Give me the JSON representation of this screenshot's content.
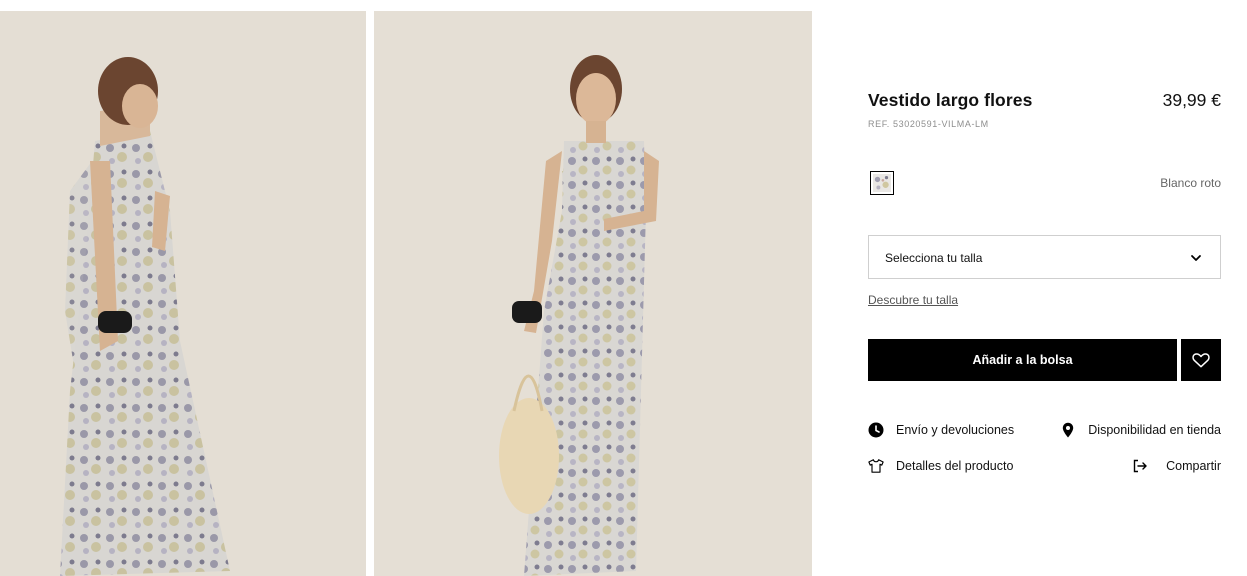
{
  "product": {
    "title": "Vestido largo flores",
    "price": "39,99 €",
    "ref": "REF. 53020591-VILMA-LM",
    "color_name": "Blanco roto"
  },
  "gallery": {
    "photos": [
      {
        "name": "back-view",
        "alt": ""
      },
      {
        "name": "front-view",
        "alt": ""
      }
    ]
  },
  "size_select": {
    "label": "Selecciona tu talla",
    "icon": "chevron-down-icon"
  },
  "size_guide_link": "Descubre tu talla",
  "actions": {
    "add_to_bag": "Añadir a la bolsa",
    "wishlist_icon": "heart-icon"
  },
  "info_links": {
    "shipping": "Envío y devoluciones",
    "store": "Disponibilidad en tienda",
    "details": "Detalles del producto",
    "share": "Compartir"
  },
  "colors": {
    "background_photo": "#e6e0d7",
    "button": "#000000",
    "text": "#111111",
    "muted": "#8e8e8e"
  }
}
